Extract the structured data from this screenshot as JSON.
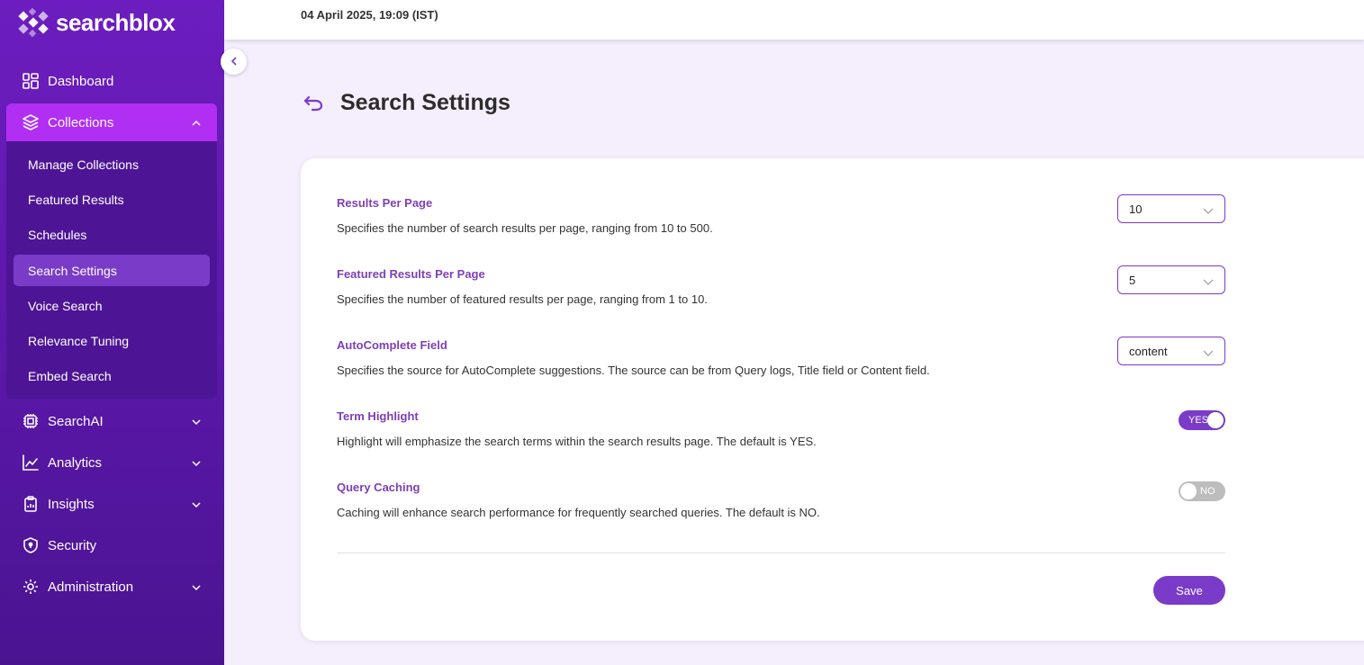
{
  "brand": {
    "name": "searchblox"
  },
  "header": {
    "timestamp": "04 April 2025, 19:09 (IST)"
  },
  "sidebar": {
    "items": [
      {
        "label": "Dashboard",
        "icon": "dashboard-icon"
      },
      {
        "label": "Collections",
        "icon": "layers-icon",
        "expanded": true
      },
      {
        "label": "SearchAI",
        "icon": "chip-icon"
      },
      {
        "label": "Analytics",
        "icon": "chart-icon"
      },
      {
        "label": "Insights",
        "icon": "clipboard-icon"
      },
      {
        "label": "Security",
        "icon": "shield-icon"
      },
      {
        "label": "Administration",
        "icon": "gear-icon"
      }
    ],
    "collections_sub": [
      "Manage Collections",
      "Featured Results",
      "Schedules",
      "Search Settings",
      "Voice Search",
      "Relevance Tuning",
      "Embed Search"
    ],
    "selected_sub": "Search Settings"
  },
  "page": {
    "title": "Search Settings"
  },
  "settings": {
    "results_per_page": {
      "label": "Results Per Page",
      "desc": "Specifies the number of search results per page, ranging from 10 to 500.",
      "value": "10"
    },
    "featured_results": {
      "label": "Featured Results Per Page",
      "desc": "Specifies the number of featured results per page, ranging from 1 to 10.",
      "value": "5"
    },
    "autocomplete": {
      "label": "AutoComplete Field",
      "desc": "Specifies the source for AutoComplete suggestions. The source can be from Query logs, Title field or Content field.",
      "value": "content"
    },
    "term_highlight": {
      "label": "Term Highlight",
      "desc": "Highlight will emphasize the search terms within the search results page. The default is YES.",
      "state": "YES"
    },
    "query_caching": {
      "label": "Query Caching",
      "desc": "Caching will enhance search performance for frequently searched queries. The default is NO.",
      "state": "NO"
    }
  },
  "actions": {
    "save_label": "Save"
  },
  "colors": {
    "accent": "#7a3bc9",
    "sidebar": "#5a17a8",
    "active": "#b12ef3",
    "label": "#7e3fb5"
  }
}
